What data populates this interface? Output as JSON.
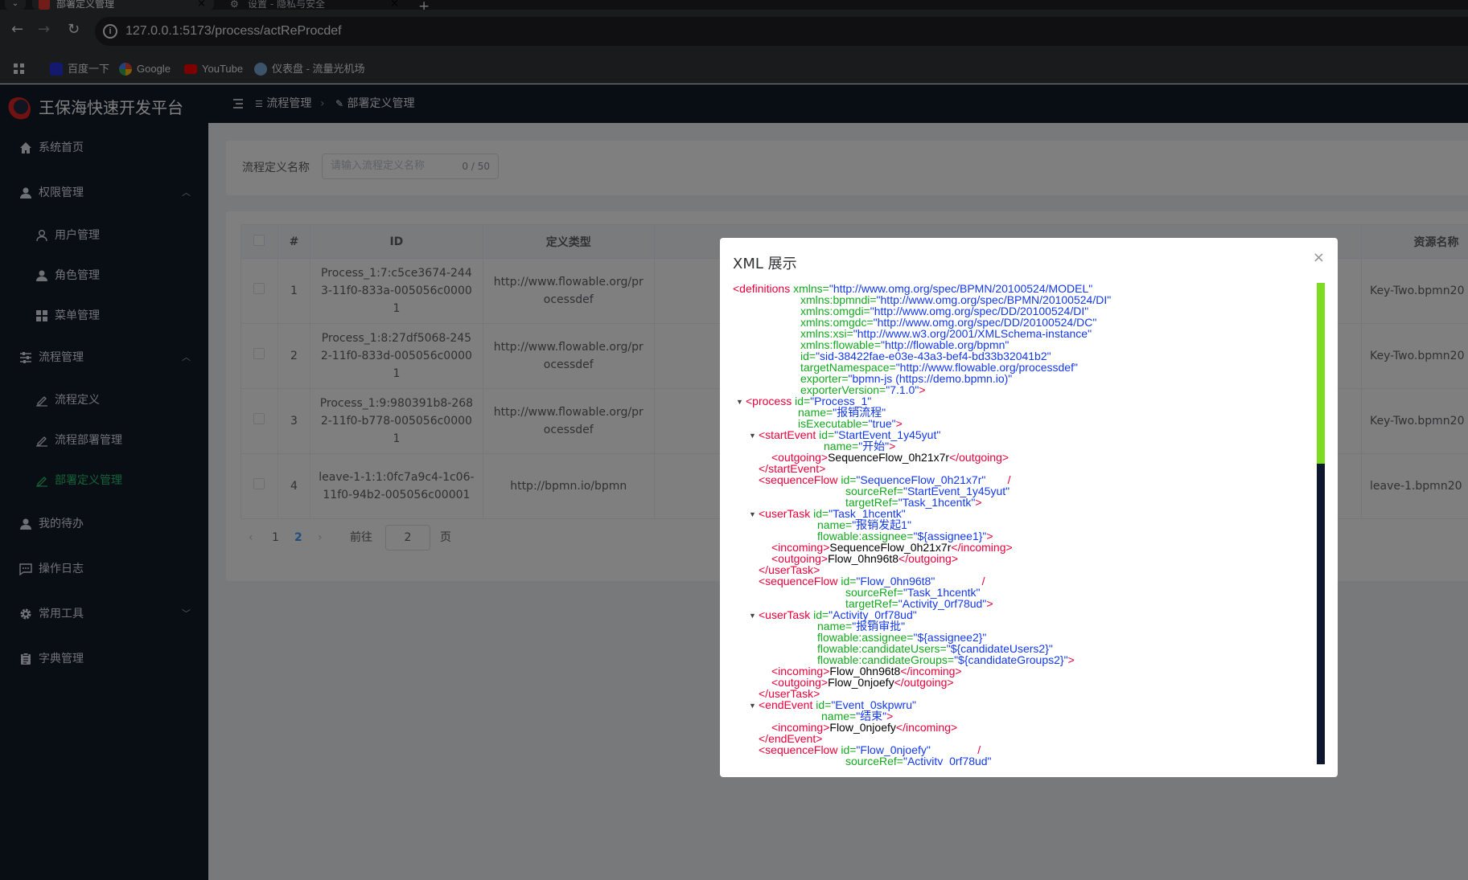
{
  "browser": {
    "tabs": [
      {
        "title": "部署定义管理",
        "active": true
      },
      {
        "title": "设置 - 隐私与安全",
        "active": false
      }
    ],
    "url": "127.0.0.1:5173/process/actReProcdef",
    "bookmarks": [
      "百度一下",
      "Google",
      "YouTube",
      "仪表盘 - 流量光机场"
    ]
  },
  "app": {
    "title": "王保海快速开发平台",
    "breadcrumb": [
      "流程管理",
      "部署定义管理"
    ],
    "menu": [
      {
        "label": "系统首页",
        "icon": "home-icon"
      },
      {
        "label": "权限管理",
        "icon": "user-icon",
        "expanded": true,
        "children": [
          {
            "label": "用户管理",
            "icon": "user-outline-icon"
          },
          {
            "label": "角色管理",
            "icon": "user-icon"
          },
          {
            "label": "菜单管理",
            "icon": "grid-icon"
          }
        ]
      },
      {
        "label": "流程管理",
        "icon": "sliders-icon",
        "expanded": true,
        "children": [
          {
            "label": "流程定义",
            "icon": "edit-icon"
          },
          {
            "label": "流程部署管理",
            "icon": "edit-icon"
          },
          {
            "label": "部署定义管理",
            "icon": "edit-icon",
            "active": true
          }
        ]
      },
      {
        "label": "我的待办",
        "icon": "user-icon"
      },
      {
        "label": "操作日志",
        "icon": "message-icon"
      },
      {
        "label": "常用工具",
        "icon": "gear-icon",
        "expanded": false
      },
      {
        "label": "字典管理",
        "icon": "clipboard-icon"
      }
    ],
    "search": {
      "label": "流程定义名称",
      "placeholder": "请输入流程定义名称",
      "count": "0 / 50"
    },
    "table": {
      "columns": [
        "#",
        "ID",
        "定义类型",
        "资源名称"
      ],
      "rows": [
        {
          "no": "1",
          "id": "Process_1:7:c5ce3674-2443-11f0-833a-005056c00001",
          "type": "http://www.flowable.org/processdef",
          "resource": "Key-Two.bpmn20"
        },
        {
          "no": "2",
          "id": "Process_1:8:27df5068-2452-11f0-833d-005056c00001",
          "type": "http://www.flowable.org/processdef",
          "resource": "Key-Two.bpmn20"
        },
        {
          "no": "3",
          "id": "Process_1:9:980391b8-2682-11f0-b778-005056c00001",
          "type": "http://www.flowable.org/processdef",
          "resource": "Key-Two.bpmn20"
        },
        {
          "no": "4",
          "id": "leave-1-1:1:0fc7a9c4-1c06-11f0-94b2-005056c00001",
          "type": "http://bpmn.io/bpmn",
          "resource": "leave-1.bpmn20"
        }
      ]
    },
    "pager": {
      "prev": "‹",
      "pages": [
        "1",
        "2"
      ],
      "current": "2",
      "next": "›",
      "goto_label": "前往",
      "goto_value": "2",
      "goto_suffix": "页"
    }
  },
  "dialog": {
    "title": "XML 展示",
    "close": "×",
    "xml_lines": [
      {
        "i": 0,
        "parts": [
          [
            "t",
            "<definitions"
          ],
          [
            "x",
            " "
          ],
          [
            "a",
            "xmlns="
          ],
          [
            "v",
            "\"http://www.omg.org/spec/BPMN/20100524/MODEL\""
          ]
        ]
      },
      {
        "i": 84,
        "parts": [
          [
            "a",
            "xmlns:bpmndi="
          ],
          [
            "v",
            "\"http://www.omg.org/spec/BPMN/20100524/DI\""
          ]
        ]
      },
      {
        "i": 84,
        "parts": [
          [
            "a",
            "xmlns:omgdi="
          ],
          [
            "v",
            "\"http://www.omg.org/spec/DD/20100524/DI\""
          ]
        ]
      },
      {
        "i": 84,
        "parts": [
          [
            "a",
            "xmlns:omgdc="
          ],
          [
            "v",
            "\"http://www.omg.org/spec/DD/20100524/DC\""
          ]
        ]
      },
      {
        "i": 84,
        "parts": [
          [
            "a",
            "xmlns:xsi="
          ],
          [
            "v",
            "\"http://www.w3.org/2001/XMLSchema-instance\""
          ]
        ]
      },
      {
        "i": 84,
        "parts": [
          [
            "a",
            "xmlns:flowable="
          ],
          [
            "v",
            "\"http://flowable.org/bpmn\""
          ]
        ]
      },
      {
        "i": 84,
        "parts": [
          [
            "a",
            "id="
          ],
          [
            "v",
            "\"sid-38422fae-e03e-43a3-bef4-bd33b32041b2\""
          ]
        ]
      },
      {
        "i": 84,
        "parts": [
          [
            "a",
            "targetNamespace="
          ],
          [
            "v",
            "\"http://www.flowable.org/processdef\""
          ]
        ]
      },
      {
        "i": 84,
        "parts": [
          [
            "a",
            "exporter="
          ],
          [
            "v",
            "\"bpmn-js (https://demo.bpmn.io)\""
          ]
        ]
      },
      {
        "i": 84,
        "parts": [
          [
            "a",
            "exporterVersion="
          ],
          [
            "v",
            "\"7.1.0\""
          ],
          [
            "t",
            ">"
          ]
        ]
      },
      {
        "i": 16,
        "tri": true,
        "parts": [
          [
            "t",
            "<process"
          ],
          [
            "x",
            " "
          ],
          [
            "a",
            "id="
          ],
          [
            "v",
            "\"Process_1\""
          ]
        ]
      },
      {
        "i": 81,
        "parts": [
          [
            "a",
            "name="
          ],
          [
            "v",
            "\"报销流程\""
          ]
        ]
      },
      {
        "i": 81,
        "parts": [
          [
            "a",
            "isExecutable="
          ],
          [
            "v",
            "\"true\""
          ],
          [
            "t",
            ">"
          ]
        ]
      },
      {
        "i": 32,
        "tri": true,
        "parts": [
          [
            "t",
            "<startEvent"
          ],
          [
            "x",
            " "
          ],
          [
            "a",
            "id="
          ],
          [
            "v",
            "\"StartEvent_1y45yut\""
          ]
        ]
      },
      {
        "i": 113,
        "parts": [
          [
            "a",
            "name="
          ],
          [
            "v",
            "\"开始\""
          ],
          [
            "t",
            ">"
          ]
        ]
      },
      {
        "i": 48,
        "parts": [
          [
            "t",
            "<outgoing>"
          ],
          [
            "x",
            "SequenceFlow_0h21x7r"
          ],
          [
            "t",
            "</outgoing>"
          ]
        ]
      },
      {
        "i": 32,
        "parts": [
          [
            "t",
            "</startEvent>"
          ]
        ]
      },
      {
        "i": 32,
        "parts": [
          [
            "t",
            "<sequenceFlow"
          ],
          [
            "x",
            " "
          ],
          [
            "a",
            "id="
          ],
          [
            "v",
            "\"SequenceFlow_0h21x7r\""
          ],
          [
            "x",
            "       "
          ],
          [
            "t",
            "/"
          ]
        ]
      },
      {
        "i": 140,
        "parts": [
          [
            "a",
            "sourceRef="
          ],
          [
            "v",
            "\"StartEvent_1y45yut\""
          ]
        ]
      },
      {
        "i": 140,
        "parts": [
          [
            "a",
            "targetRef="
          ],
          [
            "v",
            "\"Task_1hcentk\""
          ],
          [
            "t",
            ">"
          ]
        ]
      },
      {
        "i": 32,
        "tri": true,
        "parts": [
          [
            "t",
            "<userTask"
          ],
          [
            "x",
            " "
          ],
          [
            "a",
            "id="
          ],
          [
            "v",
            "\"Task_1hcentk\""
          ]
        ]
      },
      {
        "i": 105,
        "parts": [
          [
            "a",
            "name="
          ],
          [
            "v",
            "\"报销发起1\""
          ]
        ]
      },
      {
        "i": 105,
        "parts": [
          [
            "a",
            "flowable:assignee="
          ],
          [
            "v",
            "\"${assignee1}\""
          ],
          [
            "t",
            ">"
          ]
        ]
      },
      {
        "i": 48,
        "parts": [
          [
            "t",
            "<incoming>"
          ],
          [
            "x",
            "SequenceFlow_0h21x7r"
          ],
          [
            "t",
            "</incoming>"
          ]
        ]
      },
      {
        "i": 48,
        "parts": [
          [
            "t",
            "<outgoing>"
          ],
          [
            "x",
            "Flow_0hn96t8"
          ],
          [
            "t",
            "</outgoing>"
          ]
        ]
      },
      {
        "i": 32,
        "parts": [
          [
            "t",
            "</userTask>"
          ]
        ]
      },
      {
        "i": 32,
        "parts": [
          [
            "t",
            "<sequenceFlow"
          ],
          [
            "x",
            " "
          ],
          [
            "a",
            "id="
          ],
          [
            "v",
            "\"Flow_0hn96t8\""
          ],
          [
            "x",
            "               "
          ],
          [
            "t",
            "/"
          ]
        ]
      },
      {
        "i": 140,
        "parts": [
          [
            "a",
            "sourceRef="
          ],
          [
            "v",
            "\"Task_1hcentk\""
          ]
        ]
      },
      {
        "i": 140,
        "parts": [
          [
            "a",
            "targetRef="
          ],
          [
            "v",
            "\"Activity_0rf78ud\""
          ],
          [
            "t",
            ">"
          ]
        ]
      },
      {
        "i": 32,
        "tri": true,
        "parts": [
          [
            "t",
            "<userTask"
          ],
          [
            "x",
            " "
          ],
          [
            "a",
            "id="
          ],
          [
            "v",
            "\"Activity_0rf78ud\""
          ]
        ]
      },
      {
        "i": 105,
        "parts": [
          [
            "a",
            "name="
          ],
          [
            "v",
            "\"报销审批\""
          ]
        ]
      },
      {
        "i": 105,
        "parts": [
          [
            "a",
            "flowable:assignee="
          ],
          [
            "v",
            "\"${assignee2}\""
          ]
        ]
      },
      {
        "i": 105,
        "parts": [
          [
            "a",
            "flowable:candidateUsers="
          ],
          [
            "v",
            "\"${candidateUsers2}\""
          ]
        ]
      },
      {
        "i": 105,
        "parts": [
          [
            "a",
            "flowable:candidateGroups="
          ],
          [
            "v",
            "\"${candidateGroups2}\""
          ],
          [
            "t",
            ">"
          ]
        ]
      },
      {
        "i": 48,
        "parts": [
          [
            "t",
            "<incoming>"
          ],
          [
            "x",
            "Flow_0hn96t8"
          ],
          [
            "t",
            "</incoming>"
          ]
        ]
      },
      {
        "i": 48,
        "parts": [
          [
            "t",
            "<outgoing>"
          ],
          [
            "x",
            "Flow_0njoefy"
          ],
          [
            "t",
            "</outgoing>"
          ]
        ]
      },
      {
        "i": 32,
        "parts": [
          [
            "t",
            "</userTask>"
          ]
        ]
      },
      {
        "i": 32,
        "tri": true,
        "parts": [
          [
            "t",
            "<endEvent"
          ],
          [
            "x",
            " "
          ],
          [
            "a",
            "id="
          ],
          [
            "v",
            "\"Event_0skpwru\""
          ]
        ]
      },
      {
        "i": 110,
        "parts": [
          [
            "a",
            "name="
          ],
          [
            "v",
            "\"结束\""
          ],
          [
            "t",
            ">"
          ]
        ]
      },
      {
        "i": 48,
        "parts": [
          [
            "t",
            "<incoming>"
          ],
          [
            "x",
            "Flow_0njoefy"
          ],
          [
            "t",
            "</incoming>"
          ]
        ]
      },
      {
        "i": 32,
        "parts": [
          [
            "t",
            "</endEvent>"
          ]
        ]
      },
      {
        "i": 32,
        "parts": [
          [
            "t",
            "<sequenceFlow"
          ],
          [
            "x",
            " "
          ],
          [
            "a",
            "id="
          ],
          [
            "v",
            "\"Flow_0njoefy\""
          ],
          [
            "x",
            "               "
          ],
          [
            "t",
            "/"
          ]
        ]
      },
      {
        "i": 140,
        "parts": [
          [
            "a",
            "sourceRef="
          ],
          [
            "v",
            "\"Activity_0rf78ud\""
          ]
        ]
      }
    ]
  },
  "colors": {
    "sidebar_bg": "#131c2a",
    "active_menu": "#28c76f",
    "xml_tag": "#e8003a",
    "xml_attr": "#14a81f",
    "xml_value": "#1338ea",
    "scroll_thumb": "#7ddc1f"
  }
}
